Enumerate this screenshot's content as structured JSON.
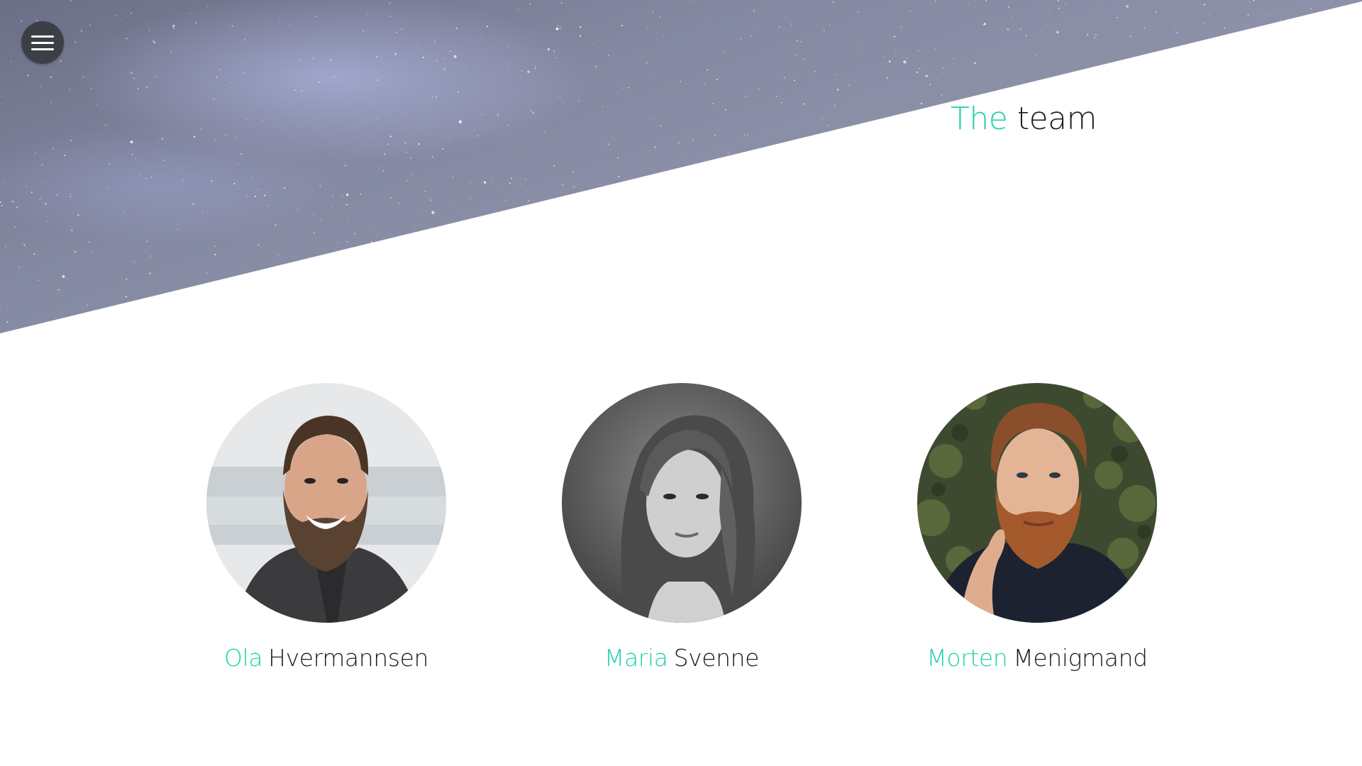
{
  "nav": {
    "menu_icon": "hamburger-menu-icon"
  },
  "hero": {
    "background": "starry-night-sky-image"
  },
  "section": {
    "title_accent": "The",
    "title_rest": "team"
  },
  "colors": {
    "accent": "#1fd1a6",
    "text": "#1c1c1c",
    "menu_button": "#3d3f46"
  },
  "team": [
    {
      "first_name": "Ola",
      "last_name": "Hvermannsen",
      "photo": "bearded-man-smiling-photo"
    },
    {
      "first_name": "Maria",
      "last_name": "Svenne",
      "photo": "woman-black-and-white-photo"
    },
    {
      "first_name": "Morten",
      "last_name": "Menigmand",
      "photo": "red-bearded-man-photo"
    }
  ]
}
